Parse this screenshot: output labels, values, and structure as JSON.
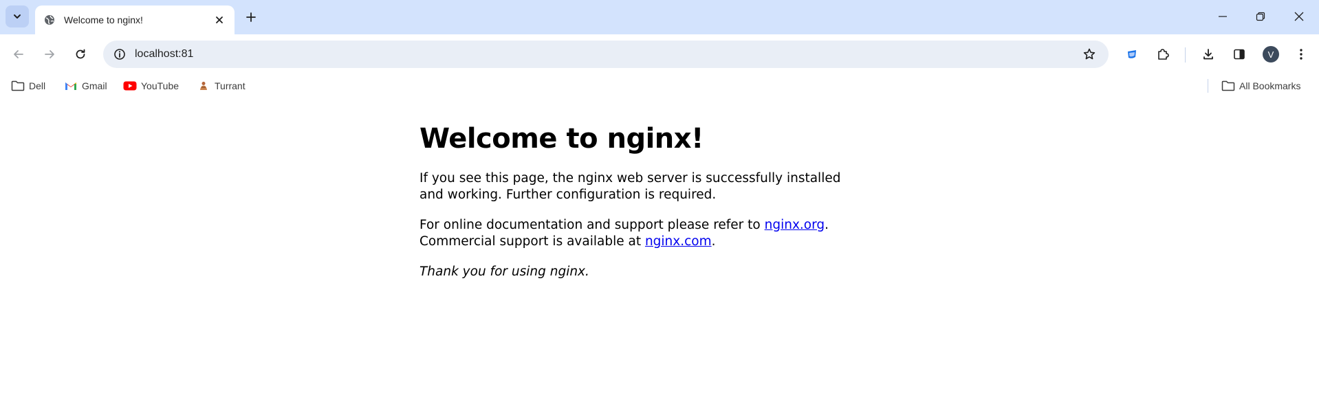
{
  "browser": {
    "tab": {
      "title": "Welcome to nginx!",
      "favicon": "globe-icon"
    },
    "omnibox": {
      "url": "localhost:81"
    },
    "profile_initial": "V"
  },
  "bookmarks": {
    "items": [
      {
        "label": "Dell",
        "icon": "folder-icon"
      },
      {
        "label": "Gmail",
        "icon": "gmail-icon"
      },
      {
        "label": "YouTube",
        "icon": "youtube-icon"
      },
      {
        "label": "Turrant",
        "icon": "turrant-icon"
      }
    ],
    "all_label": "All Bookmarks"
  },
  "page": {
    "heading": "Welcome to nginx!",
    "para1": "If you see this page, the nginx web server is successfully installed and working. Further configuration is required.",
    "para2_prefix": "For online documentation and support please refer to ",
    "link_org": "nginx.org",
    "para2_mid": ".",
    "para2_line2": "Commercial support is available at ",
    "link_com": "nginx.com",
    "para2_end": ".",
    "thanks": "Thank you for using nginx."
  },
  "colors": {
    "tabstrip": "#d3e3fd",
    "omnibox": "#e9eef6",
    "link": "#0000ee"
  }
}
